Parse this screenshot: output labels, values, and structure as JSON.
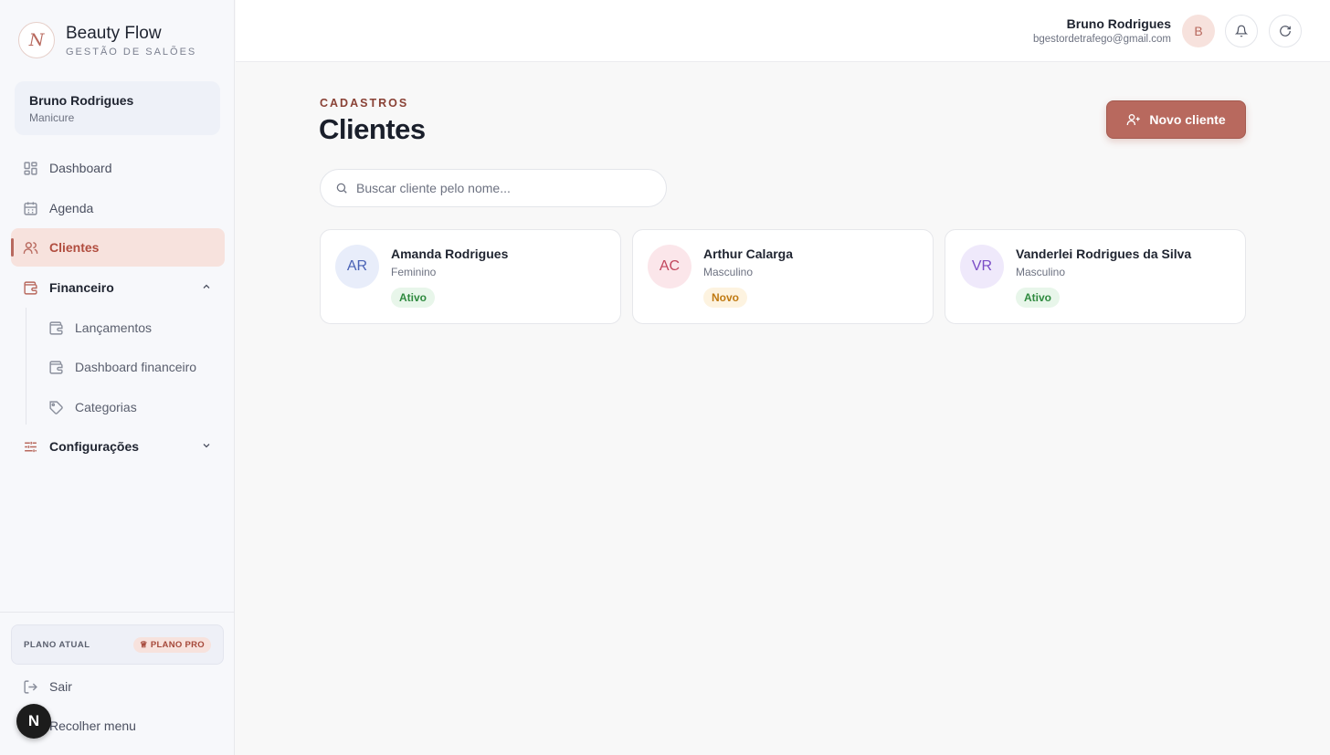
{
  "brand": {
    "initial": "N",
    "name": "Beauty Flow",
    "subtitle": "GESTÃO DE SALÕES"
  },
  "sidebar_user": {
    "name": "Bruno Rodrigues",
    "role": "Manicure"
  },
  "nav": {
    "dashboard": "Dashboard",
    "agenda": "Agenda",
    "clientes": "Clientes",
    "financeiro": "Financeiro",
    "lancamentos": "Lançamentos",
    "dashboard_financeiro": "Dashboard financeiro",
    "categorias": "Categorias",
    "configuracoes": "Configurações"
  },
  "plan": {
    "label": "PLANO ATUAL",
    "badge": "PLANO PRO"
  },
  "footer": {
    "logout": "Sair",
    "collapse": "Recolher menu",
    "floating_initial": "N"
  },
  "header": {
    "user_name": "Bruno Rodrigues",
    "user_email": "bgestordetrafego@gmail.com",
    "avatar_initial": "B"
  },
  "page": {
    "kicker": "CADASTROS",
    "title": "Clientes",
    "new_button": "Novo cliente",
    "search_placeholder": "Buscar cliente pelo nome..."
  },
  "clients": [
    {
      "initials": "AR",
      "name": "Amanda Rodrigues",
      "gender": "Feminino",
      "status": "Ativo",
      "avatar_bg": "#e8edfa",
      "avatar_fg": "#4a63b6",
      "badge_bg": "#e8f6ea",
      "badge_fg": "#2f8a3f"
    },
    {
      "initials": "AC",
      "name": "Arthur Calarga",
      "gender": "Masculino",
      "status": "Novo",
      "avatar_bg": "#fbe6ea",
      "avatar_fg": "#c2475d",
      "badge_bg": "#fdf3e0",
      "badge_fg": "#c07a12"
    },
    {
      "initials": "VR",
      "name": "Vanderlei Rodrigues da Silva",
      "gender": "Masculino",
      "status": "Ativo",
      "avatar_bg": "#efe9fb",
      "avatar_fg": "#7a4cc6",
      "badge_bg": "#e8f6ea",
      "badge_fg": "#2f8a3f"
    }
  ],
  "colors": {
    "accent": "#b8695e",
    "active_bg": "#f7e2dd"
  }
}
